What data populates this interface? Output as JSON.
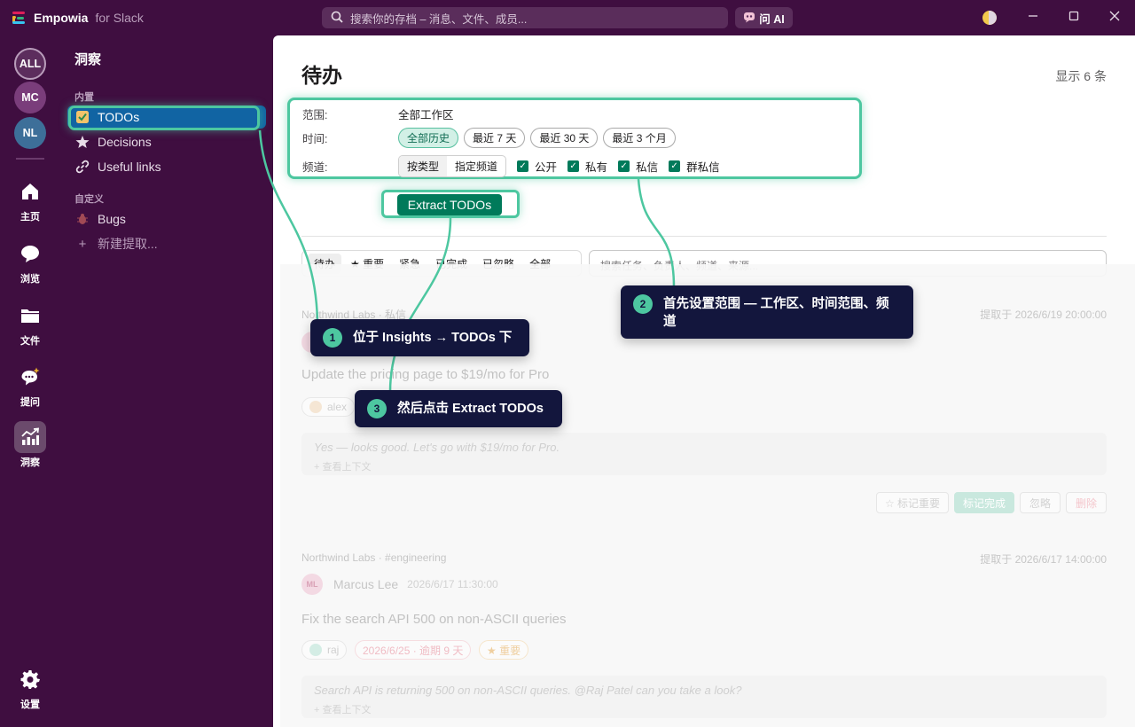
{
  "titlebar": {
    "brand_name": "Empowia",
    "brand_sub": "for Slack",
    "search_placeholder": "搜索你的存档 – 消息、文件、成员...",
    "ask_ai": "问 AI",
    "logo_colors": [
      "#e01e5a",
      "#ecb22e",
      "#2eb67d",
      "#36c5f0"
    ]
  },
  "rail": {
    "workspaces": [
      {
        "label": "ALL",
        "color": "#5c2d5d"
      },
      {
        "label": "MC",
        "color": "#7a3d7b"
      },
      {
        "label": "NL",
        "color": "#3d6f99"
      }
    ],
    "items": [
      {
        "label": "主页",
        "icon": "home-icon"
      },
      {
        "label": "浏览",
        "icon": "chat-bubble-icon"
      },
      {
        "label": "文件",
        "icon": "folder-icon"
      },
      {
        "label": "提问",
        "icon": "ask-bubble-icon"
      },
      {
        "label": "洞察",
        "icon": "insights-chart-icon"
      }
    ],
    "settings": "设置"
  },
  "sidebar": {
    "title": "洞察",
    "builtin_label": "内置",
    "custom_label": "自定义",
    "items": [
      {
        "label": "TODOs",
        "icon": "checkbox-icon"
      },
      {
        "label": "Decisions",
        "icon": "star-icon"
      },
      {
        "label": "Useful links",
        "icon": "link-icon"
      }
    ],
    "custom_items": [
      {
        "label": "Bugs",
        "icon": "bug-icon"
      }
    ],
    "new_extract": "新建提取..."
  },
  "main": {
    "title": "待办",
    "showing": "显示 6 条",
    "filters": {
      "scope_label": "范围:",
      "scope_value": "全部工作区",
      "time_label": "时间:",
      "time_options": [
        "全部历史",
        "最近 7 天",
        "最近 30 天",
        "最近 3 个月"
      ],
      "channel_label": "频道:",
      "channel_modes": [
        "按类型",
        "指定频道"
      ],
      "channel_types": [
        "公开",
        "私有",
        "私信",
        "群私信"
      ]
    },
    "extract_button": "Extract TODOs",
    "tabs": [
      "待办",
      "★ 重要",
      "紧急",
      "已完成",
      "已忽略",
      "全部"
    ],
    "task_search_placeholder": "搜索任务、负责人、频道、来源..."
  },
  "cards": [
    {
      "source": "Northwind Labs · 私信",
      "extracted": "提取于 2026/6/19 20:00:00",
      "title": "Update the pricing page to $19/mo for Pro",
      "assignee": "alex",
      "quote": "Yes — looks good. Let's go with $19/mo for Pro.",
      "context": "+ 查看上下文",
      "actions": [
        "☆ 标记重要",
        "标记完成",
        "忽略",
        "删除"
      ]
    },
    {
      "source": "Northwind Labs · #engineering",
      "extracted": "提取于 2026/6/17 14:00:00",
      "author_initials": "ML",
      "author": "Marcus Lee",
      "time": "2026/6/17 11:30:00",
      "title": "Fix the search API 500 on non-ASCII queries",
      "assignee": "raj",
      "due": "2026/6/25 · 逾期 9 天",
      "priority": "★ 重要",
      "quote": "Search API is returning 500 on non-ASCII queries. @Raj Patel can you take a look?",
      "context": "+ 查看上下文"
    }
  ],
  "callouts": [
    {
      "num": "1",
      "text": "位于 Insights → TODOs 下"
    },
    {
      "num": "2",
      "text": "首先设置范围 — 工作区、时间范围、频道"
    },
    {
      "num": "3",
      "text": "然后点击 Extract TODOs"
    }
  ],
  "accent_color": "#4dc7a0",
  "sidebar_bg": "#3f0e40",
  "active_blue": "#1164a3",
  "primary_green": "#007a5a"
}
